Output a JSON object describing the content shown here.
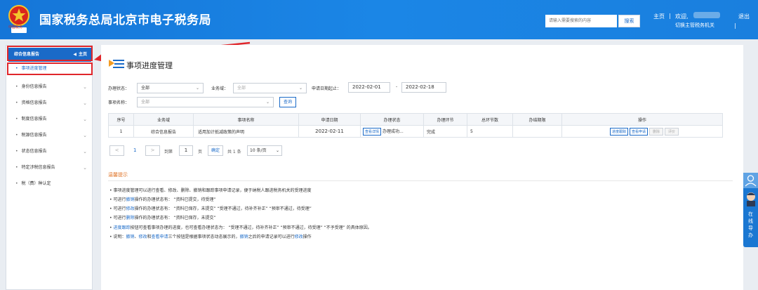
{
  "header": {
    "title": "国家税务总局北京市电子税务局",
    "emblem_caption": "中国税务",
    "search_placeholder": "请输入需要搜索的内容",
    "search_button": "搜索",
    "home_link": "主页",
    "welcome": "欢迎,",
    "switch_link": "切换主管税务机关",
    "logout_link": "退出"
  },
  "sidebar": {
    "title": "综合信息报告",
    "home_label": "主页",
    "active_item": "事项进度管理",
    "items": [
      {
        "label": "身份信息报告",
        "has_chevron": true
      },
      {
        "label": "资格信息报告",
        "has_chevron": true
      },
      {
        "label": "制度信息报告",
        "has_chevron": true
      },
      {
        "label": "税源信息报告",
        "has_chevron": true
      },
      {
        "label": "状态信息报告",
        "has_chevron": true
      },
      {
        "label": "特定涉税信息报告",
        "has_chevron": true
      },
      {
        "label": "税（费）种认定",
        "has_chevron": false
      }
    ]
  },
  "page": {
    "title": "事项进度管理",
    "filters": {
      "status_label": "办理状态：",
      "status_value": "全部",
      "business_label": "业务域：",
      "business_value": "全部",
      "date_label": "申请日期起止：",
      "date_from": "2022-02-01",
      "date_sep": "-",
      "date_to": "2022-02-18",
      "item_label": "事项名称：",
      "item_value": "全部",
      "query_button": "查询"
    },
    "table": {
      "headers": [
        "序号",
        "业务域",
        "事项名称",
        "申请日期",
        "办理状态",
        "办理环节",
        "总环节数",
        "办结期限",
        "操作"
      ],
      "rows": [
        {
          "index": "1",
          "domain": "综合信息报告",
          "name": "适用加计抵减政策的声明",
          "date": "2022-02-11",
          "status_btn": "查看详情",
          "status": "办理成功...",
          "stage": "完成",
          "total": "5",
          "deadline": "",
          "actions": [
            "进度跟踪",
            "查看申请",
            "删除",
            "评价"
          ]
        }
      ]
    },
    "pagination": {
      "prev": "<",
      "page": "1",
      "next": ">",
      "goto_label": "到第",
      "goto_value": "1",
      "page_unit": "页",
      "confirm": "确定",
      "total": "共 1 条",
      "per_page": "10 条/页"
    },
    "tips": {
      "title": "温馨提示",
      "lines": [
        {
          "parts": [
            {
              "t": "事项进度管理可以进行查看、修改、删除、撤销和跟踪事项申请记录，便于纳税人跟进税务机关的受理进度",
              "c": ""
            }
          ]
        },
        {
          "parts": [
            {
              "t": "可进行",
              "c": ""
            },
            {
              "t": "撤销",
              "c": "blue"
            },
            {
              "t": "操作的办理状态有：  “资料已提交，待受理”",
              "c": ""
            }
          ]
        },
        {
          "parts": [
            {
              "t": "可进行",
              "c": ""
            },
            {
              "t": "修改",
              "c": "blue"
            },
            {
              "t": "操作的办理状态有：  “资料已保存，未提交”   “受理不通过，待补齐补正”   “预审不通过，待受理”",
              "c": ""
            }
          ]
        },
        {
          "parts": [
            {
              "t": "可进行",
              "c": ""
            },
            {
              "t": "删除",
              "c": "blue"
            },
            {
              "t": "操作的办理状态有：  “资料已保存，未提交”",
              "c": ""
            }
          ]
        },
        {
          "parts": [
            {
              "t": "进度跟踪",
              "c": "blue"
            },
            {
              "t": "按钮可查看事项办理的进度，也可查看办理状态为：  “受理不通过，待补齐补正”   “预审不通过，待受理”   “不予受理” 的具体原因。",
              "c": ""
            }
          ]
        },
        {
          "parts": [
            {
              "t": "说明：",
              "c": ""
            },
            {
              "t": "撤销",
              "c": "blue"
            },
            {
              "t": "、",
              "c": ""
            },
            {
              "t": "修改",
              "c": "blue"
            },
            {
              "t": "和",
              "c": ""
            },
            {
              "t": "查看申请",
              "c": "blue"
            },
            {
              "t": "三个按钮是根据事项状态动态展示的，",
              "c": ""
            },
            {
              "t": "撤销",
              "c": "blue"
            },
            {
              "t": "之后的申请记录可以进行",
              "c": ""
            },
            {
              "t": "修改",
              "c": "blue"
            },
            {
              "t": "操作",
              "c": ""
            }
          ]
        }
      ]
    }
  },
  "float_panel": {
    "label": "在线导办"
  },
  "colors": {
    "header_blue": "#1a7fde",
    "accent": "#1a6ac8",
    "annotation_red": "#e0262b",
    "tip_title": "#e0762b"
  }
}
